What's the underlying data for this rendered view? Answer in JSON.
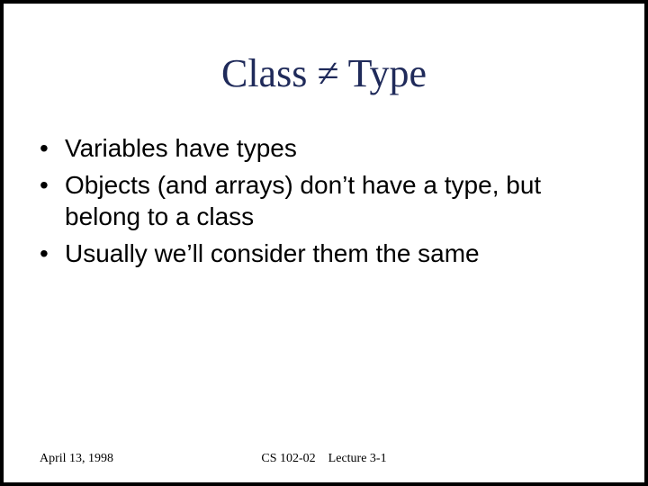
{
  "title": "Class ≠ Type",
  "bullets": [
    "Variables have types",
    "Objects (and arrays) don’t have a type, but belong to a class",
    "Usually we’ll consider them the same"
  ],
  "footer": {
    "date": "April 13, 1998",
    "center": "CS 102-02    Lecture 3-1"
  }
}
